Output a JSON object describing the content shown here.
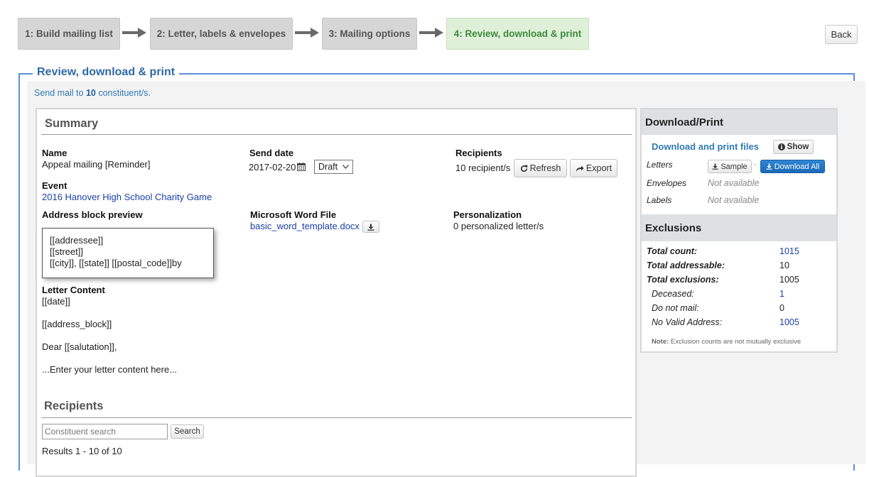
{
  "wizard": {
    "steps": [
      {
        "label": "1: Build mailing list"
      },
      {
        "label": "2: Letter, labels & envelopes"
      },
      {
        "label": "3: Mailing options"
      },
      {
        "label": "4: Review, download & print"
      }
    ],
    "back_label": "Back"
  },
  "page": {
    "legend": "Review, download & print",
    "send_prefix": "Send mail to ",
    "send_count": "10",
    "send_suffix": " constituent/s."
  },
  "summary": {
    "title": "Summary",
    "name_label": "Name",
    "name_value": "Appeal mailing [Reminder]",
    "event_label": "Event",
    "event_value": "2016 Hanover High School Charity Game",
    "send_date_label": "Send date",
    "send_date_value": "2017-02-20",
    "status_selected": "Draft",
    "recipients_label": "Recipients",
    "recipients_value": "10 recipient/s",
    "refresh_label": "Refresh",
    "export_label": "Export",
    "address_label": "Address block preview",
    "address_lines": [
      "[[addressee]]",
      "[[street]]",
      "[[city]], [[state]] [[postal_code]]by"
    ],
    "word_label": "Microsoft Word File",
    "word_file": "basic_word_template.docx",
    "personalization_label": "Personalization",
    "personalization_value": "0 personalized letter/s",
    "letter_label": "Letter Content",
    "letter_lines": [
      "[[date]]",
      "[[address_block]]",
      "Dear [[salutation]],",
      "...Enter your letter content here..."
    ]
  },
  "recipients": {
    "title": "Recipients",
    "search_placeholder": "Constituent search",
    "search_button": "Search",
    "results_text": "Results 1 - 10 of 10"
  },
  "download": {
    "title": "Download/Print",
    "files_link": "Download and print files",
    "show_label": "Show",
    "letters_label": "Letters",
    "sample_label": "Sample",
    "separator": "·",
    "download_all_label": "Download All",
    "envelopes_label": "Envelopes",
    "envelopes_value": "Not available",
    "labels_label": "Labels",
    "labels_value": "Not available"
  },
  "exclusions": {
    "title": "Exclusions",
    "rows": [
      {
        "label": "Total count:",
        "value": "1015"
      },
      {
        "label": "Total addressable:",
        "value": "10"
      },
      {
        "label": "Total exclusions:",
        "value": "1005"
      },
      {
        "label": "Deceased:",
        "value": "1"
      },
      {
        "label": "Do not mail:",
        "value": "0"
      },
      {
        "label": "No Valid Address:",
        "value": "1005"
      }
    ],
    "note_bold": "Note:",
    "note_text": " Exclusion counts are not mutually exclusive"
  },
  "colors": {
    "accent_blue": "#2f6aa8",
    "frame_blue": "#5b8fd8",
    "active_step_bg": "#dff0d8",
    "active_step_text": "#3c8a3c",
    "link_blue": "#1a3fa8",
    "primary_button": "#1c69b6"
  }
}
